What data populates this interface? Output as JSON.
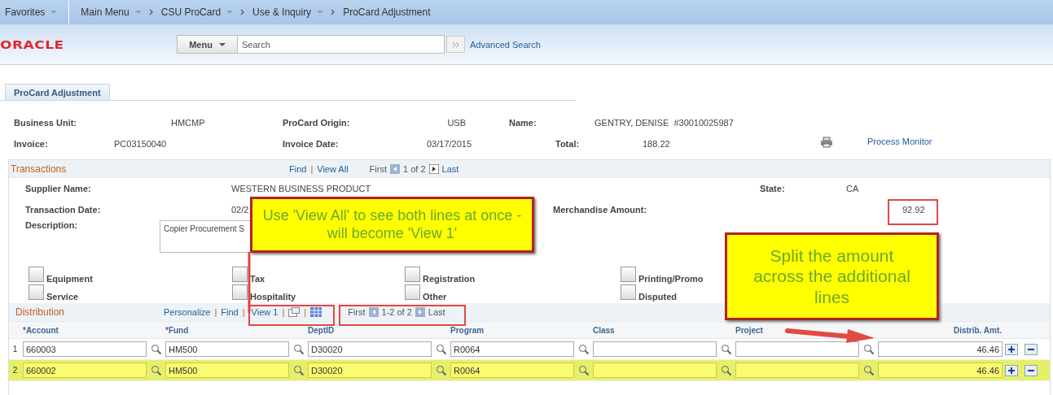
{
  "breadcrumbs": [
    {
      "label": "Favorites",
      "has_menu": true
    },
    {
      "label": "Main Menu",
      "has_menu": true
    },
    {
      "label": "CSU ProCard",
      "has_menu": true
    },
    {
      "label": "Use & Inquiry",
      "has_menu": true
    },
    {
      "label": "ProCard Adjustment",
      "has_menu": false
    }
  ],
  "header": {
    "logo": "ORACLE",
    "menu_button": "Menu",
    "search": {
      "placeholder": "Search"
    },
    "advanced_search": "Advanced Search"
  },
  "page_tab": {
    "label": "ProCard Adjustment",
    "selected": true
  },
  "summary": [
    [
      {
        "label": "Business Unit:",
        "value": "HMCMP"
      },
      {
        "label": "ProCard Origin:",
        "value": "USB"
      },
      {
        "label": "Name:",
        "value": "GENTRY, DENISE  #30010025987"
      }
    ],
    [
      {
        "label": "Invoice:",
        "value": "PC03150040"
      },
      {
        "label": "Invoice Date:",
        "value": "03/17/2015"
      },
      {
        "label": "Total:",
        "value": "188.22"
      }
    ]
  ],
  "process_monitor": "Process Monitor",
  "transactions": {
    "title": "Transactions",
    "separator": "|",
    "find": "Find",
    "view_all": "View All",
    "first": "First",
    "position": "1 of 2",
    "last": "Last",
    "supplier_label": "Supplier Name:",
    "supplier": "WESTERN BUSINESS PRODUCT",
    "state_label": "State:",
    "state": "CA",
    "date_label": "Transaction Date:",
    "date": "02/2",
    "amount_label": "Merchandise Amount:",
    "amount": "92.92",
    "description_label": "Description:",
    "description": "Copier Procurement S",
    "categories": [
      {
        "label": "Equipment",
        "checked": false
      },
      {
        "label": "Service",
        "checked": false
      },
      {
        "label": "Tax",
        "checked": false
      },
      {
        "label": "Hospitality",
        "checked": false
      },
      {
        "label": "Registration",
        "checked": false
      },
      {
        "label": "Other",
        "checked": false
      },
      {
        "label": "Printing/Promo",
        "checked": false
      },
      {
        "label": "Disputed",
        "checked": false
      }
    ]
  },
  "distribution": {
    "title": "Distribution",
    "separators": [
      "|",
      "|",
      "|",
      "|"
    ],
    "personalize": "Personalize",
    "find": "Find",
    "view": "View 1",
    "first": "First",
    "position": "1-2 of 2",
    "last": "Last",
    "columns": [
      "*Account",
      "*Fund",
      "DeptID",
      "Program",
      "Class",
      "Project",
      "Distrib. Amt."
    ],
    "rows": [
      {
        "number": "1",
        "selected": false,
        "cells": [
          "660003",
          "HM500",
          "D30020",
          "R0064",
          "",
          "",
          "46.46"
        ]
      },
      {
        "number": "2",
        "selected": true,
        "cells": [
          "660002",
          "HM500",
          "D30020",
          "R0064",
          "",
          "",
          "46.46"
        ]
      }
    ]
  },
  "callouts": [
    {
      "text": "Use 'View All' to see both lines at once - will become 'View 1'"
    },
    {
      "text": "Split the amount across the additional lines"
    }
  ]
}
